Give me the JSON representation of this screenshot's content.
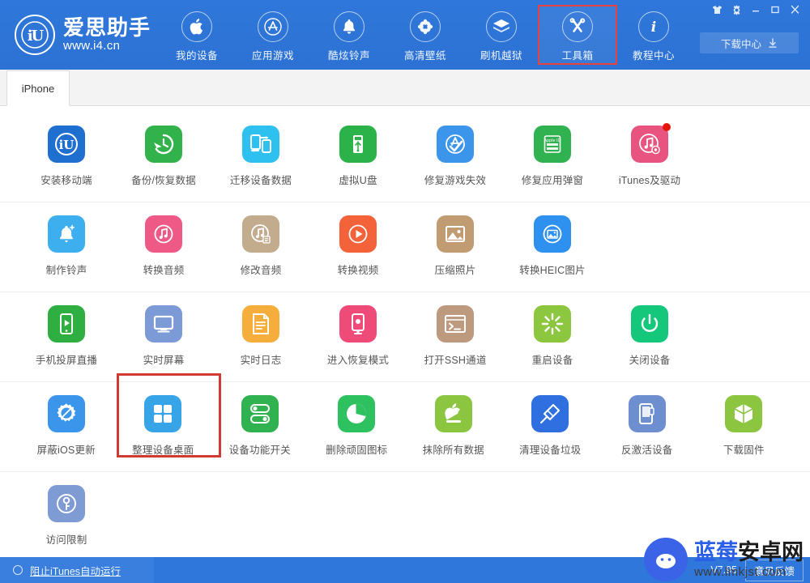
{
  "header": {
    "brand_mark": "iU",
    "brand_name": "爱思助手",
    "brand_url": "www.i4.cn",
    "download_center": "下载中心",
    "download_icon": "download-icon",
    "nav": [
      {
        "label": "我的设备",
        "icon": "apple-icon",
        "selected": false
      },
      {
        "label": "应用游戏",
        "icon": "appstore-icon",
        "selected": false
      },
      {
        "label": "酷炫铃声",
        "icon": "bell-icon",
        "selected": false
      },
      {
        "label": "高清壁纸",
        "icon": "flower-icon",
        "selected": false
      },
      {
        "label": "刷机越狱",
        "icon": "box-icon",
        "selected": false
      },
      {
        "label": "工具箱",
        "icon": "tools-icon",
        "selected": true
      },
      {
        "label": "教程中心",
        "icon": "info-icon",
        "selected": false
      }
    ],
    "window_buttons": [
      {
        "name": "shirt-icon",
        "glyph": "👕"
      },
      {
        "name": "gear-icon",
        "glyph": "⚙"
      },
      {
        "name": "minimize-icon",
        "glyph": "—"
      },
      {
        "name": "maximize-icon",
        "glyph": "▭"
      },
      {
        "name": "close-icon",
        "glyph": "✕"
      }
    ]
  },
  "tabs": [
    {
      "label": "iPhone",
      "active": true
    }
  ],
  "tool_rows": [
    [
      {
        "label": "安装移动端",
        "icon": "i4-app-icon",
        "color": "#1f6fd0",
        "badge": false,
        "highlighted": false
      },
      {
        "label": "备份/恢复数据",
        "icon": "backup-restore-icon",
        "color": "#32b24a",
        "badge": false,
        "highlighted": false
      },
      {
        "label": "迁移设备数据",
        "icon": "device-migrate-icon",
        "color": "#2ec0ef",
        "badge": false,
        "highlighted": false
      },
      {
        "label": "虚拟U盘",
        "icon": "usb-drive-icon",
        "color": "#2bb34a",
        "badge": false,
        "highlighted": false
      },
      {
        "label": "修复游戏失效",
        "icon": "fix-game-icon",
        "color": "#3b95ea",
        "badge": false,
        "highlighted": false
      },
      {
        "label": "修复应用弹窗",
        "icon": "appleid-popup-icon",
        "color": "#2fb24f",
        "badge": false,
        "highlighted": false
      },
      {
        "label": "iTunes及驱动",
        "icon": "itunes-driver-icon",
        "color": "#e8537f",
        "badge": true,
        "highlighted": false
      }
    ],
    [
      {
        "label": "制作铃声",
        "icon": "make-ringtone-icon",
        "color": "#3eafee",
        "badge": false,
        "highlighted": false
      },
      {
        "label": "转换音频",
        "icon": "convert-audio-icon",
        "color": "#ef5986",
        "badge": false,
        "highlighted": false
      },
      {
        "label": "修改音频",
        "icon": "edit-audio-icon",
        "color": "#c3ab8e",
        "badge": false,
        "highlighted": false
      },
      {
        "label": "转换视频",
        "icon": "convert-video-icon",
        "color": "#f4623a",
        "badge": false,
        "highlighted": false
      },
      {
        "label": "压缩照片",
        "icon": "compress-photo-icon",
        "color": "#c19b72",
        "badge": false,
        "highlighted": false
      },
      {
        "label": "转换HEIC图片",
        "icon": "convert-heic-icon",
        "color": "#2e90ef",
        "badge": false,
        "highlighted": false
      }
    ],
    [
      {
        "label": "手机投屏直播",
        "icon": "screen-cast-icon",
        "color": "#2fae41",
        "badge": false,
        "highlighted": false
      },
      {
        "label": "实时屏幕",
        "icon": "realtime-screen-icon",
        "color": "#7b9ad6",
        "badge": false,
        "highlighted": false
      },
      {
        "label": "实时日志",
        "icon": "realtime-log-icon",
        "color": "#f5ad3c",
        "badge": false,
        "highlighted": false
      },
      {
        "label": "进入恢复模式",
        "icon": "recovery-mode-icon",
        "color": "#ef4b79",
        "badge": false,
        "highlighted": false
      },
      {
        "label": "打开SSH通道",
        "icon": "ssh-tunnel-icon",
        "color": "#bd9a7d",
        "badge": false,
        "highlighted": false
      },
      {
        "label": "重启设备",
        "icon": "restart-device-icon",
        "color": "#8dc63f",
        "badge": false,
        "highlighted": false
      },
      {
        "label": "关闭设备",
        "icon": "shutdown-device-icon",
        "color": "#14c77a",
        "badge": false,
        "highlighted": false
      }
    ],
    [
      {
        "label": "屏蔽iOS更新",
        "icon": "block-ios-update-icon",
        "color": "#3b95ea",
        "badge": false,
        "highlighted": false
      },
      {
        "label": "整理设备桌面",
        "icon": "organize-desktop-icon",
        "color": "#38a4e8",
        "badge": false,
        "highlighted": true
      },
      {
        "label": "设备功能开关",
        "icon": "feature-toggle-icon",
        "color": "#2fb24f",
        "badge": false,
        "highlighted": false
      },
      {
        "label": "删除顽固图标",
        "icon": "delete-icon-icon",
        "color": "#2ec15f",
        "badge": false,
        "highlighted": false
      },
      {
        "label": "抹除所有数据",
        "icon": "erase-data-icon",
        "color": "#8cc540",
        "badge": false,
        "highlighted": false
      },
      {
        "label": "清理设备垃圾",
        "icon": "clean-junk-icon",
        "color": "#2f6fe0",
        "badge": false,
        "highlighted": false
      },
      {
        "label": "反激活设备",
        "icon": "deactivate-device-icon",
        "color": "#6e8fcf",
        "badge": false,
        "highlighted": false
      },
      {
        "label": "下载固件",
        "icon": "download-firmware-icon",
        "color": "#8cc540",
        "badge": false,
        "highlighted": false
      }
    ],
    [
      {
        "label": "访问限制",
        "icon": "access-restriction-icon",
        "color": "#7e9bd4",
        "badge": false,
        "highlighted": false
      }
    ]
  ],
  "statusbar": {
    "block_itunes": "阻止iTunes自动运行",
    "version": "V7.95",
    "feedback": "意见反馈"
  },
  "watermark": {
    "name_blue": "蓝莓",
    "name_dark": "安卓网",
    "url": "www.lmkjst.com"
  }
}
